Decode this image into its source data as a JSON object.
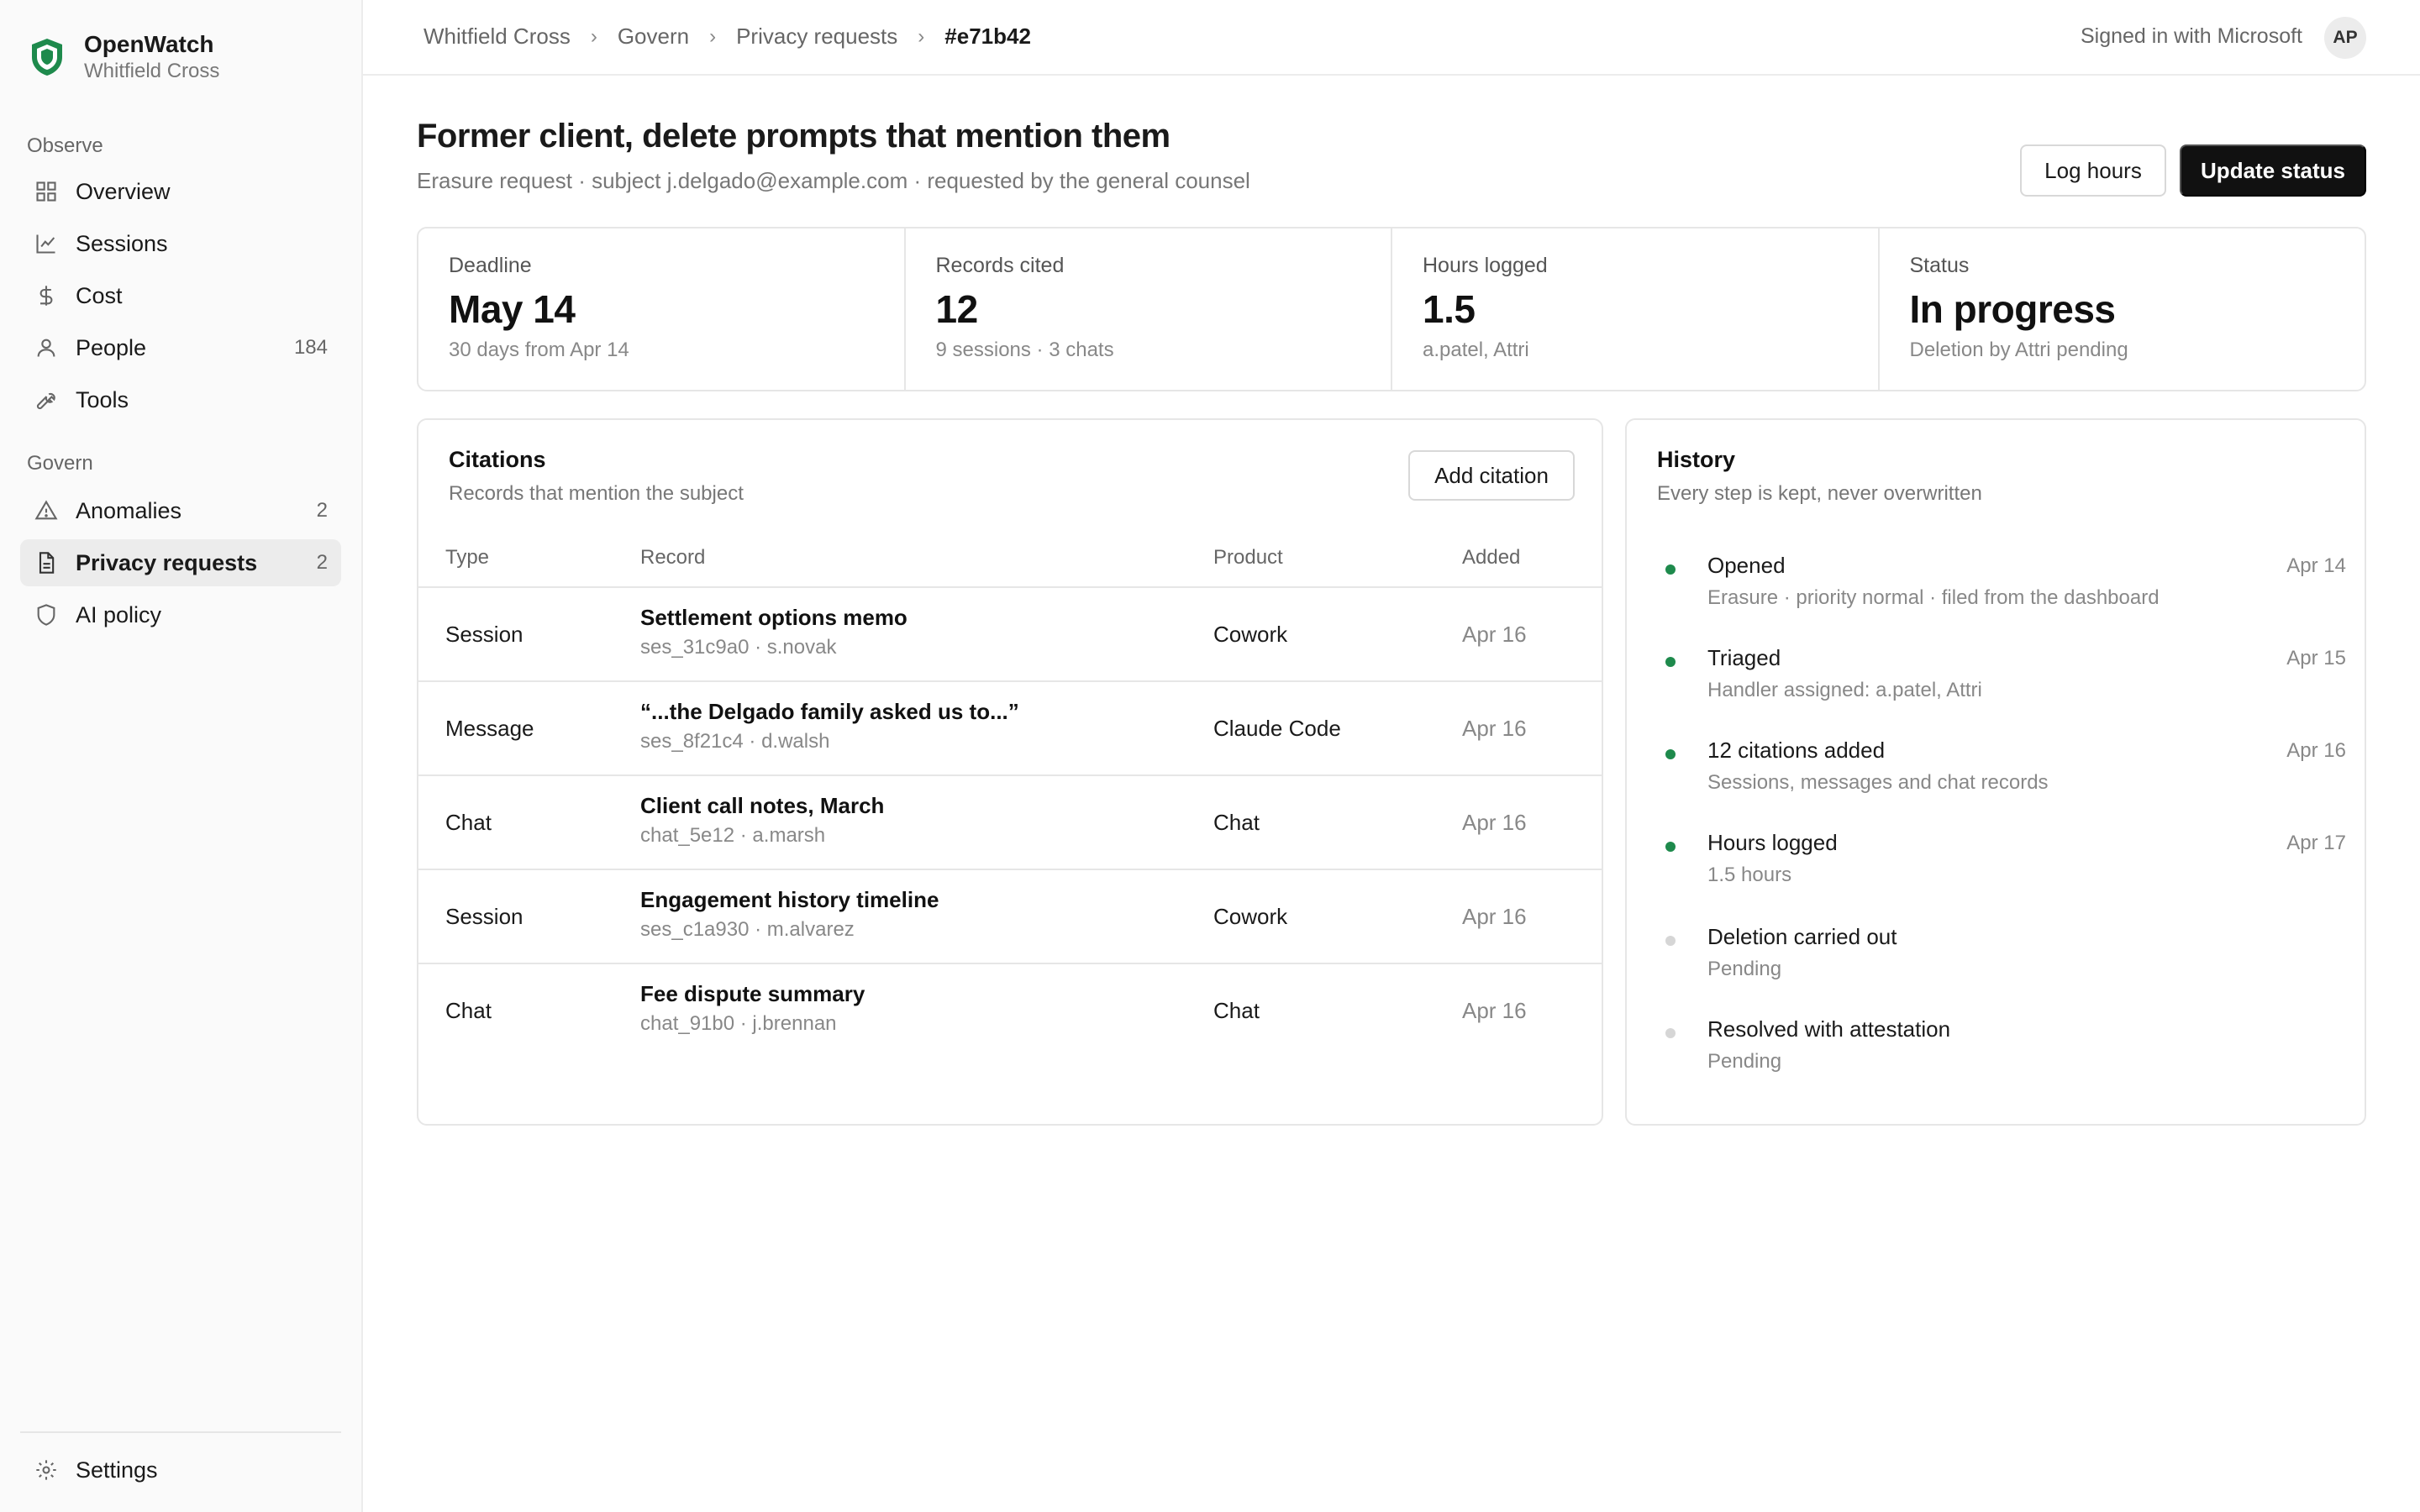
{
  "brand": {
    "name": "OpenWatch",
    "org": "Whitfield Cross",
    "accent": "#1e8a4c"
  },
  "sidebar": {
    "sections": [
      {
        "title": "Observe",
        "items": [
          {
            "label": "Overview",
            "icon": "grid-icon",
            "count": ""
          },
          {
            "label": "Sessions",
            "icon": "chart-line-icon",
            "count": ""
          },
          {
            "label": "Cost",
            "icon": "dollar-icon",
            "count": ""
          },
          {
            "label": "People",
            "icon": "user-icon",
            "count": "184"
          },
          {
            "label": "Tools",
            "icon": "wrench-icon",
            "count": ""
          }
        ]
      },
      {
        "title": "Govern",
        "items": [
          {
            "label": "Anomalies",
            "icon": "warning-icon",
            "count": "2"
          },
          {
            "label": "Privacy requests",
            "icon": "document-icon",
            "count": "2",
            "active": true
          },
          {
            "label": "AI policy",
            "icon": "shield-icon",
            "count": ""
          }
        ]
      }
    ],
    "settings_label": "Settings"
  },
  "topbar": {
    "breadcrumb": [
      "Whitfield Cross",
      "Govern",
      "Privacy requests",
      "#e71b42"
    ],
    "signed_in": "Signed in with Microsoft",
    "avatar": "AP"
  },
  "header": {
    "title": "Former client, delete prompts that mention them",
    "subtitle": "Erasure request · subject j.delgado@example.com · requested by the general counsel",
    "log_hours_label": "Log hours",
    "update_status_label": "Update status"
  },
  "stats": [
    {
      "label": "Deadline",
      "value": "May 14",
      "note": "30 days from Apr 14"
    },
    {
      "label": "Records cited",
      "value": "12",
      "note": "9 sessions · 3 chats"
    },
    {
      "label": "Hours logged",
      "value": "1.5",
      "note": "a.patel, Attri"
    },
    {
      "label": "Status",
      "value": "In progress",
      "note": "Deletion by Attri pending"
    }
  ],
  "citations": {
    "title": "Citations",
    "subtitle": "Records that mention the subject",
    "add_label": "Add citation",
    "columns": [
      "Type",
      "Record",
      "Product",
      "Added"
    ],
    "rows": [
      {
        "type": "Session",
        "record": "Settlement options memo",
        "meta": "ses_31c9a0 · s.novak",
        "product": "Cowork",
        "added": "Apr 16"
      },
      {
        "type": "Message",
        "record": "“...the Delgado family asked us to...”",
        "meta": "ses_8f21c4 · d.walsh",
        "product": "Claude Code",
        "added": "Apr 16"
      },
      {
        "type": "Chat",
        "record": "Client call notes, March",
        "meta": "chat_5e12 · a.marsh",
        "product": "Chat",
        "added": "Apr 16"
      },
      {
        "type": "Session",
        "record": "Engagement history timeline",
        "meta": "ses_c1a930 · m.alvarez",
        "product": "Cowork",
        "added": "Apr 16"
      },
      {
        "type": "Chat",
        "record": "Fee dispute summary",
        "meta": "chat_91b0 · j.brennan",
        "product": "Chat",
        "added": "Apr 16"
      }
    ]
  },
  "history": {
    "title": "History",
    "subtitle": "Every step is kept, never overwritten",
    "items": [
      {
        "title": "Opened",
        "detail": "Erasure · priority normal · filed from the dashboard",
        "date": "Apr 14",
        "state": "done"
      },
      {
        "title": "Triaged",
        "detail": "Handler assigned: a.patel, Attri",
        "date": "Apr 15",
        "state": "done"
      },
      {
        "title": "12 citations added",
        "detail": "Sessions, messages and chat records",
        "date": "Apr 16",
        "state": "done"
      },
      {
        "title": "Hours logged",
        "detail": "1.5 hours",
        "date": "Apr 17",
        "state": "done"
      },
      {
        "title": "Deletion carried out",
        "detail": "Pending",
        "date": "",
        "state": "pending"
      },
      {
        "title": "Resolved with attestation",
        "detail": "Pending",
        "date": "",
        "state": "pending"
      }
    ]
  }
}
